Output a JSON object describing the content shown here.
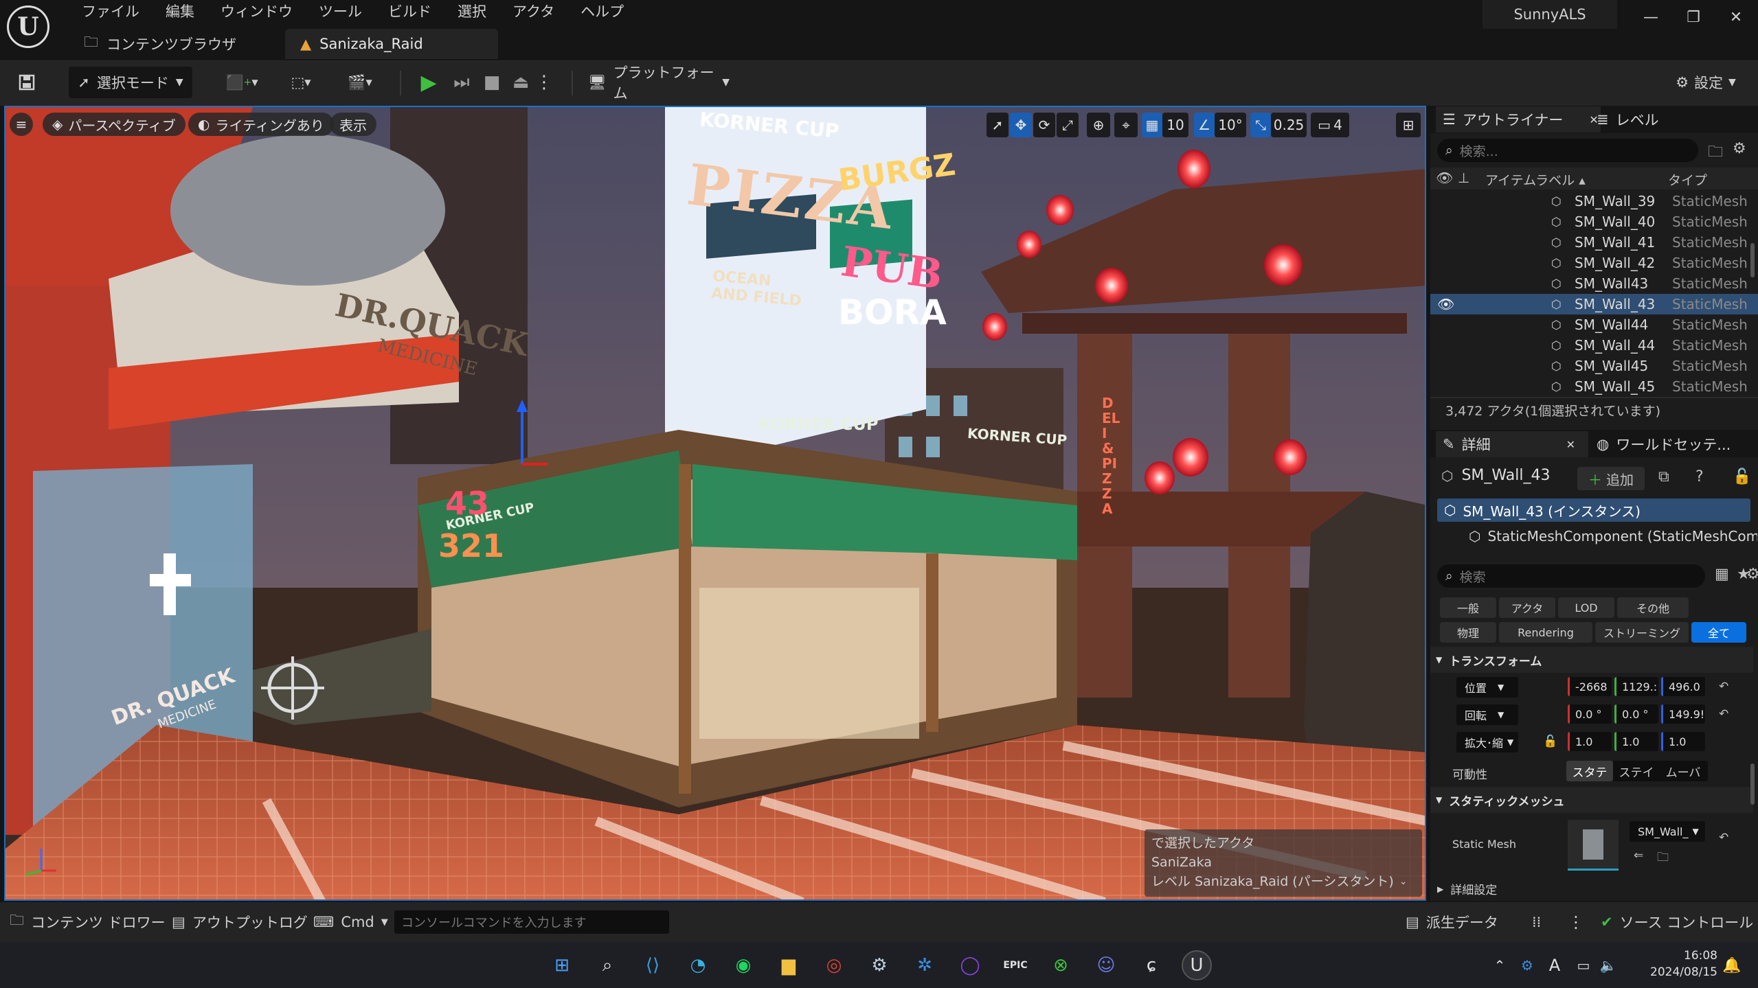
{
  "window": {
    "project_name": "SunnyALS",
    "minimize": "—",
    "restore": "❐",
    "close": "✕"
  },
  "menu": [
    "ファイル",
    "編集",
    "ウィンドウ",
    "ツール",
    "ビルド",
    "選択",
    "アクタ",
    "ヘルプ"
  ],
  "tabs": [
    {
      "label": "コンテンツブラウザ",
      "icon": "folder-icon",
      "active": false
    },
    {
      "label": "Sanizaka_Raid",
      "icon": "level-icon",
      "active": true
    }
  ],
  "toolbar": {
    "save_icon": "save-icon",
    "mode_label": "選択モード",
    "platform_label": "プラットフォーム",
    "settings_label": "設定"
  },
  "viewport": {
    "perspective_label": "パースペクティブ",
    "lighting_label": "ライティングあり",
    "show_label": "表示",
    "grid_snap": "10",
    "rotation_snap": "10°",
    "scale_snap": "0.25",
    "camera_speed": "4",
    "overlay_line1": "で選択したアクタ",
    "overlay_line2": "SaniZaka",
    "overlay_line3": "レベル  Sanizaka_Raid (パーシスタント)",
    "signs": {
      "pizza": "PIZZA",
      "pub": "PUB",
      "burgz": "BURGZ",
      "bora": "BORA",
      "ocean_field": "OCEAN AND FIELD",
      "korner_cup_sign": "KORNER CUP",
      "dr_quack": "DR.QUACK",
      "medicine": "MEDICINE",
      "awning1": "KORNER CUP",
      "awning2": "KORNER CUP",
      "awning3": "KORNER CUP",
      "deli": "DELI & PIZZA",
      "neon_a": "43",
      "neon_b": "321",
      "glass_dr": "DR. QUACK",
      "glass_med": "MEDICINE"
    }
  },
  "outliner": {
    "tab_label": "アウトライナー",
    "levels_label": "レベル",
    "search_placeholder": "検索...",
    "col_label": "アイテムラベル ▴",
    "col_type": "タイプ",
    "rows": [
      {
        "name": "SM_Wall_39",
        "type": "StaticMesh"
      },
      {
        "name": "SM_Wall_40",
        "type": "StaticMesh"
      },
      {
        "name": "SM_Wall_41",
        "type": "StaticMesh"
      },
      {
        "name": "SM_Wall_42",
        "type": "StaticMesh"
      },
      {
        "name": "SM_Wall43",
        "type": "StaticMesh"
      },
      {
        "name": "SM_Wall_43",
        "type": "StaticMesh",
        "selected": true
      },
      {
        "name": "SM_Wall44",
        "type": "StaticMesh"
      },
      {
        "name": "SM_Wall_44",
        "type": "StaticMesh"
      },
      {
        "name": "SM_Wall45",
        "type": "StaticMesh"
      },
      {
        "name": "SM_Wall_45",
        "type": "StaticMesh"
      }
    ],
    "status": "3,472 アクタ(1個選択されています)"
  },
  "details": {
    "tab_label": "詳細",
    "world_label": "ワールドセッテ...",
    "actor_name": "SM_Wall_43",
    "add_label": "追加",
    "component_root": "SM_Wall_43 (インスタンス)",
    "component_child": "StaticMeshComponent (StaticMeshCompo",
    "search_placeholder": "検索",
    "filters_row1": [
      "一般",
      "アクタ",
      "LOD",
      "その他"
    ],
    "filters_row2": [
      "物理",
      "Rendering",
      "ストリーミング",
      "全て"
    ],
    "transform_header": "トランスフォーム",
    "location_label": "位置",
    "location": [
      "-2668",
      "1129.:",
      "496.0"
    ],
    "rotation_label": "回転",
    "rotation": [
      "0.0 °",
      "0.0 °",
      "149.9!"
    ],
    "scale_label": "拡大･縮",
    "scale": [
      "1.0",
      "1.0",
      "1.0"
    ],
    "mobility_label": "可動性",
    "mobility_options": [
      "スタテ",
      "ステイ",
      "ムーバ"
    ],
    "static_mesh_header": "スタティックメッシュ",
    "static_mesh_label": "Static Mesh",
    "static_mesh_value": "SM_Wall_",
    "advanced_label": "詳細設定"
  },
  "bottombar": {
    "content_drawer": "コンテンツ ドロワー",
    "output_log": "アウトプットログ",
    "cmd": "Cmd",
    "console_placeholder": "コンソールコマンドを入力します",
    "derived_data": "派生データ",
    "source_control": "ソース コントロール"
  },
  "taskbar": {
    "time": "16:08",
    "date": "2024/08/15",
    "ime": "A"
  },
  "colors": {
    "accent": "#0a70e0",
    "selected_row": "#2f4e73",
    "play_green": "#3fbf3f"
  }
}
